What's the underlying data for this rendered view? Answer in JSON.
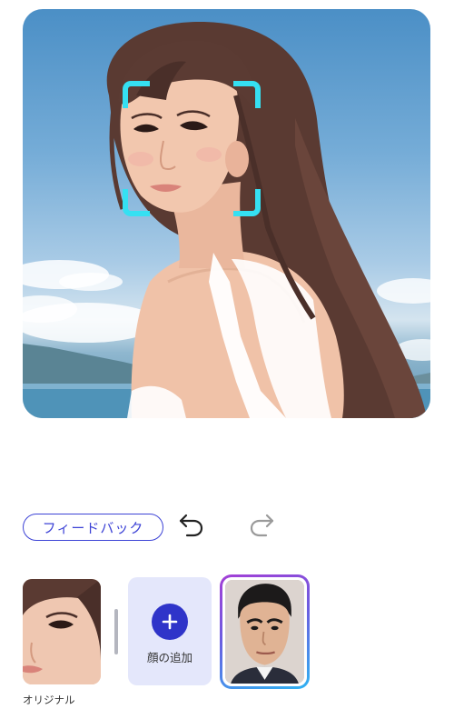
{
  "photo": {
    "subject": "woman-with-long-brown-hair-by-the-sea",
    "face_frame_color": "#35e0f2"
  },
  "toolbar": {
    "feedback_label": "フィードバック",
    "undo_icon": "undo-arrow-icon",
    "redo_icon": "redo-arrow-icon",
    "accent_color": "#3d43d6"
  },
  "faces": {
    "original_label": "オリジナル",
    "add_face_label": "顔の追加",
    "add_icon": "plus-icon",
    "selected_border_colors": [
      "#a43fd6",
      "#2fb2f2"
    ]
  }
}
